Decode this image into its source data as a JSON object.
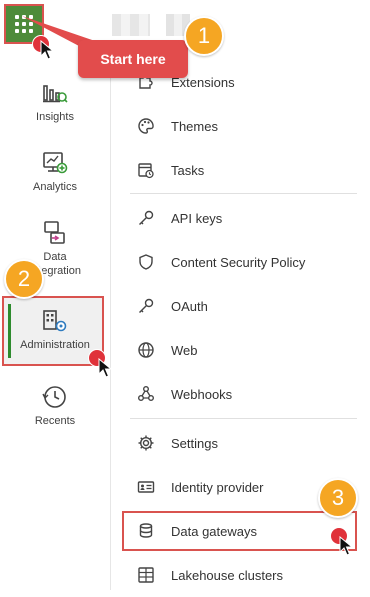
{
  "colors": {
    "accent": "#4e8b3a",
    "callout": "#e24c4c",
    "badge": "#f5a623",
    "active_indicator": "#2e8b2e"
  },
  "sidebar": {
    "items": [
      {
        "label": "Insights",
        "icon": "insights-icon"
      },
      {
        "label": "Analytics",
        "icon": "analytics-icon"
      },
      {
        "label": "Data",
        "label2": "Integration",
        "icon": "data-integration-icon"
      },
      {
        "label": "Administration",
        "icon": "administration-icon"
      },
      {
        "label": "Recents",
        "icon": "recents-icon"
      }
    ]
  },
  "menu": {
    "items": [
      {
        "label": "Extensions",
        "icon": "puzzle-icon"
      },
      {
        "label": "Themes",
        "icon": "palette-icon"
      },
      {
        "label": "Tasks",
        "icon": "calendar-clock-icon"
      },
      {
        "label": "API keys",
        "icon": "key-icon"
      },
      {
        "label": "Content Security Policy",
        "icon": "shield-icon"
      },
      {
        "label": "OAuth",
        "icon": "key-icon"
      },
      {
        "label": "Web",
        "icon": "globe-icon"
      },
      {
        "label": "Webhooks",
        "icon": "webhooks-icon"
      },
      {
        "label": "Settings",
        "icon": "gear-icon"
      },
      {
        "label": "Identity provider",
        "icon": "id-card-icon"
      },
      {
        "label": "Data gateways",
        "icon": "database-icon"
      },
      {
        "label": "Lakehouse clusters",
        "icon": "cluster-icon"
      }
    ]
  },
  "annotations": {
    "tooltip": "Start here",
    "steps": [
      "1",
      "2",
      "3"
    ]
  }
}
